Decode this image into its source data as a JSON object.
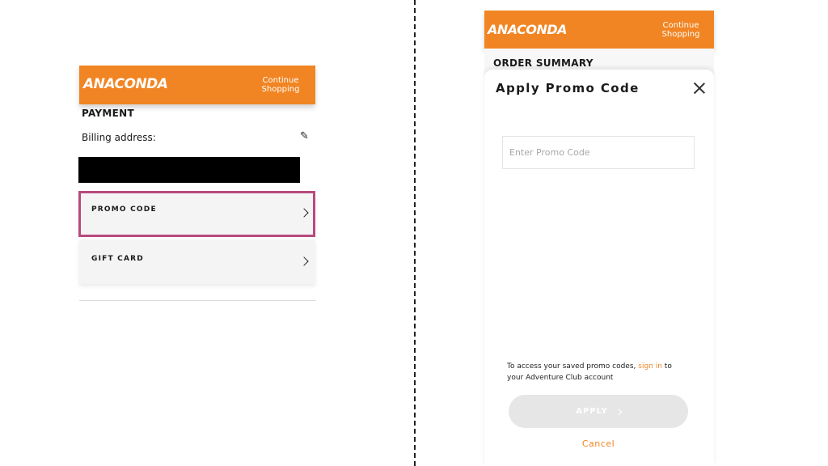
{
  "left": {
    "brand": "ANACONDA",
    "continue_line1": "Continue",
    "continue_line2": "Shopping",
    "section_title": "PAYMENT",
    "billing_label": "Billing address:",
    "promo_label": "PROMO CODE",
    "gift_label": "GIFT CARD"
  },
  "right": {
    "brand": "ANACONDA",
    "continue_line1": "Continue",
    "continue_line2": "Shopping",
    "section_title": "ORDER SUMMARY",
    "modal_title": "Apply Promo Code",
    "input_placeholder": "Enter Promo Code",
    "input_value": "",
    "info_prefix": "To access your saved promo codes,",
    "info_link": "sign in",
    "info_mid": "to",
    "info_suffix": "your Adventure Club account",
    "apply_label": "APPLY",
    "cancel_label": "Cancel"
  },
  "colors": {
    "brand_orange": "#f18523",
    "highlight": "#b84a7e"
  },
  "icons": [
    "pencil-icon",
    "chevron-right-icon",
    "close-icon"
  ]
}
